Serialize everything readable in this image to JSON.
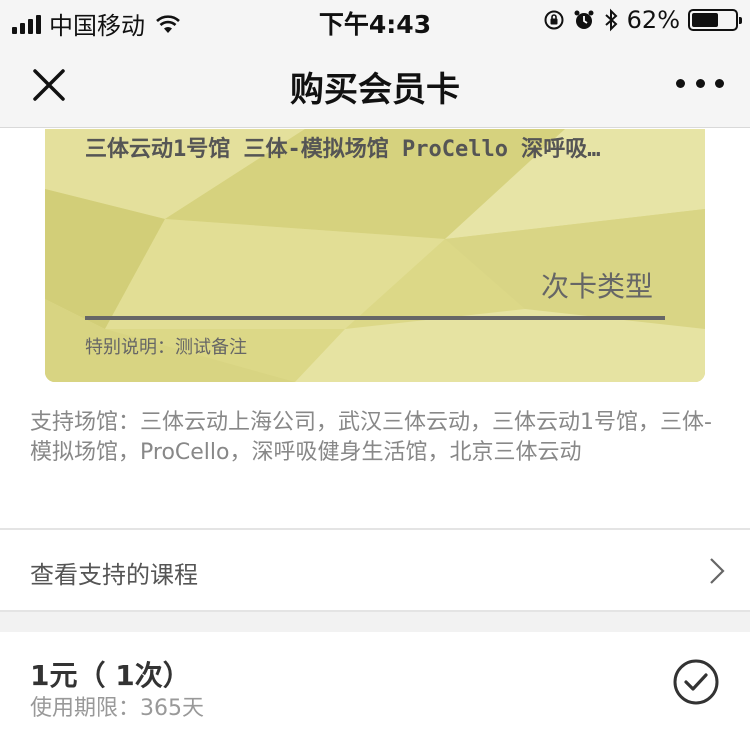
{
  "status_bar": {
    "carrier": "中国移动",
    "time": "下午4:43",
    "battery_percent": "62%",
    "battery_level": 0.62
  },
  "nav": {
    "title": "购买会员卡"
  },
  "card": {
    "venues": "三体云动1号馆 三体-模拟场馆 ProCello 深呼吸…",
    "type_label": "次卡类型",
    "note_label": "特别说明：",
    "note_value": "测试备注",
    "color": "#dcd887"
  },
  "support": {
    "text": "支持场馆：三体云动上海公司，武汉三体云动，三体云动1号馆，三体-模拟场馆，ProCello，深呼吸健身生活馆，北京三体云动"
  },
  "courses": {
    "label": "查看支持的课程"
  },
  "option": {
    "price": "1元（ 1次）",
    "validity_label": "使用期限：",
    "validity_value": "365天"
  }
}
